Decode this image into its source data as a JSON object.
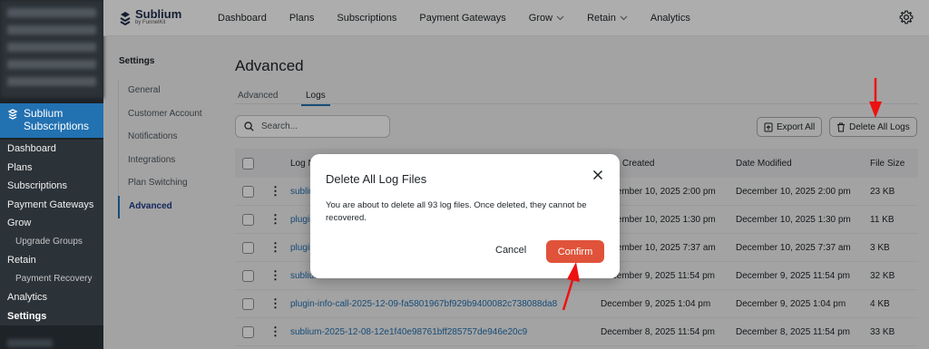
{
  "wp_sidebar": {
    "current_menu": "Sublium Subscriptions",
    "submenu": [
      {
        "label": "Dashboard",
        "child": false,
        "current": false
      },
      {
        "label": "Plans",
        "child": false,
        "current": false
      },
      {
        "label": "Subscriptions",
        "child": false,
        "current": false
      },
      {
        "label": "Payment Gateways",
        "child": false,
        "current": false
      },
      {
        "label": "Grow",
        "child": false,
        "current": false
      },
      {
        "label": "Upgrade Groups",
        "child": true,
        "current": false
      },
      {
        "label": "Retain",
        "child": false,
        "current": false
      },
      {
        "label": "Payment Recovery",
        "child": true,
        "current": false
      },
      {
        "label": "Analytics",
        "child": false,
        "current": false
      },
      {
        "label": "Settings",
        "child": false,
        "current": true
      }
    ]
  },
  "topnav": {
    "brand": "Sublium",
    "brand_by": "by FunnelKit",
    "items": [
      "Dashboard",
      "Plans",
      "Subscriptions",
      "Payment Gateways",
      "Grow",
      "Retain",
      "Analytics"
    ]
  },
  "settings": {
    "title": "Settings",
    "menu": [
      "General",
      "Customer Account",
      "Notifications",
      "Integrations",
      "Plan Switching",
      "Advanced"
    ]
  },
  "main": {
    "title": "Advanced",
    "tabs": [
      "Advanced",
      "Logs"
    ],
    "search_placeholder": "Search...",
    "export_label": "Export All",
    "delete_label": "Delete All Logs",
    "columns": [
      "Log Name",
      "Date Created",
      "Date Modified",
      "File Size"
    ],
    "rows": [
      {
        "name": "sublium-2025-12-10",
        "created": "December 10, 2025 2:00 pm",
        "modified": "December 10, 2025 2:00 pm",
        "size": "23 KB"
      },
      {
        "name": "plugin-info-call-2025-12-10",
        "created": "December 10, 2025 1:30 pm",
        "modified": "December 10, 2025 1:30 pm",
        "size": "11 KB"
      },
      {
        "name": "plugin-info-call-2025-12-10",
        "created": "December 10, 2025 7:37 am",
        "modified": "December 10, 2025 7:37 am",
        "size": "3 KB"
      },
      {
        "name": "sublium-2025-12-09",
        "created": "December 9, 2025 11:54 pm",
        "modified": "December 9, 2025 11:54 pm",
        "size": "32 KB"
      },
      {
        "name": "plugin-info-call-2025-12-09-fa5801967bf929b9400082c738088da8",
        "created": "December 9, 2025 1:04 pm",
        "modified": "December 9, 2025 1:04 pm",
        "size": "4 KB"
      },
      {
        "name": "sublium-2025-12-08-12e1f40e98761bff285757de946e20c9",
        "created": "December 8, 2025 11:54 pm",
        "modified": "December 8, 2025 11:54 pm",
        "size": "33 KB"
      }
    ]
  },
  "modal": {
    "title": "Delete All Log Files",
    "body": "You are about to delete all 93 log files. Once deleted, they cannot be recovered.",
    "cancel_label": "Cancel",
    "confirm_label": "Confirm"
  },
  "colors": {
    "wp_dark": "#1d2327",
    "wp_blue": "#2271b1",
    "confirm": "#e0533a",
    "annotation_arrow": "#ee1111"
  }
}
